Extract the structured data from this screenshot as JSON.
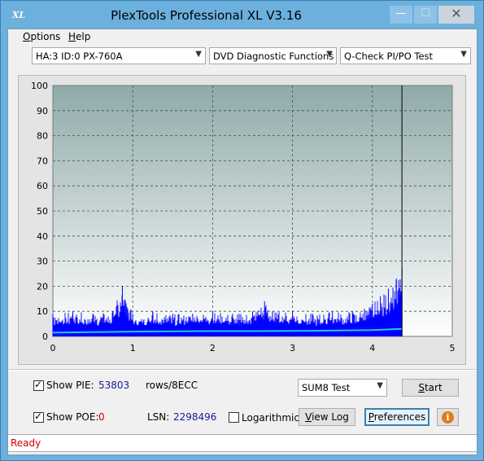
{
  "window": {
    "title": "PlexTools Professional XL V3.16",
    "icon_text": "XL",
    "controls": {
      "minimize": "—",
      "maximize": "☐",
      "close": "✕"
    }
  },
  "menu": {
    "options": {
      "first": "O",
      "rest": "ptions"
    },
    "help": {
      "first": "H",
      "rest": "elp"
    }
  },
  "selectors": {
    "drive": "HA:3 ID:0  PX-760A",
    "function": "DVD Diagnostic Functions",
    "test": "Q-Check PI/PO Test"
  },
  "chart_data": {
    "type": "bar",
    "title": "",
    "xlabel": "",
    "ylabel": "",
    "xlim": [
      0,
      5
    ],
    "ylim": [
      0,
      100
    ],
    "x_ticks": [
      "0",
      "1",
      "2",
      "3",
      "4",
      "5"
    ],
    "y_ticks": [
      "0",
      "10",
      "20",
      "30",
      "40",
      "50",
      "60",
      "70",
      "80",
      "90",
      "100"
    ],
    "grid": true,
    "data_end_x": 4.37,
    "series": [
      {
        "color": "#0000ff",
        "style": "spikes",
        "x": [
          0.0,
          0.25,
          0.5,
          0.75,
          0.87,
          1.0,
          1.25,
          1.5,
          1.75,
          2.0,
          2.25,
          2.5,
          2.65,
          2.75,
          3.0,
          3.25,
          3.5,
          3.75,
          3.9,
          4.0,
          4.1,
          4.2,
          4.3,
          4.37
        ],
        "values": [
          9,
          10,
          9,
          10,
          20,
          9,
          10,
          9,
          9,
          10,
          9,
          10,
          14,
          10,
          10,
          9,
          10,
          10,
          11,
          13,
          16,
          19,
          23,
          27
        ]
      },
      {
        "color": "#22c8e0",
        "style": "line",
        "x": [
          0.0,
          0.5,
          1.0,
          1.5,
          2.0,
          2.5,
          3.0,
          3.5,
          4.0,
          4.37
        ],
        "values": [
          1.5,
          1.7,
          1.9,
          2.0,
          2.1,
          2.1,
          2.2,
          2.3,
          2.5,
          3.0
        ]
      }
    ]
  },
  "controls": {
    "show_pie": {
      "label": "Show PIE:",
      "checked": true,
      "value": "53803",
      "unit": "rows/8ECC"
    },
    "show_poe": {
      "label": "Show POE:",
      "checked": true,
      "value": "0"
    },
    "lsn": {
      "label": "LSN:",
      "value": "2298496"
    },
    "logarithmic": {
      "label": "Logarithmic",
      "checked": false
    },
    "test_mode": "SUM8 Test",
    "start_button": {
      "first": "S",
      "rest": "tart"
    },
    "view_log_button": {
      "first": "V",
      "rest": "iew Log"
    },
    "preferences_button": {
      "first": "P",
      "rest": "references"
    },
    "info_button": "i"
  },
  "status": {
    "text": "Ready"
  },
  "colors": {
    "pie_spikes": "#0000ff",
    "poe_line": "#22c8e0",
    "status_text": "#d00000"
  }
}
